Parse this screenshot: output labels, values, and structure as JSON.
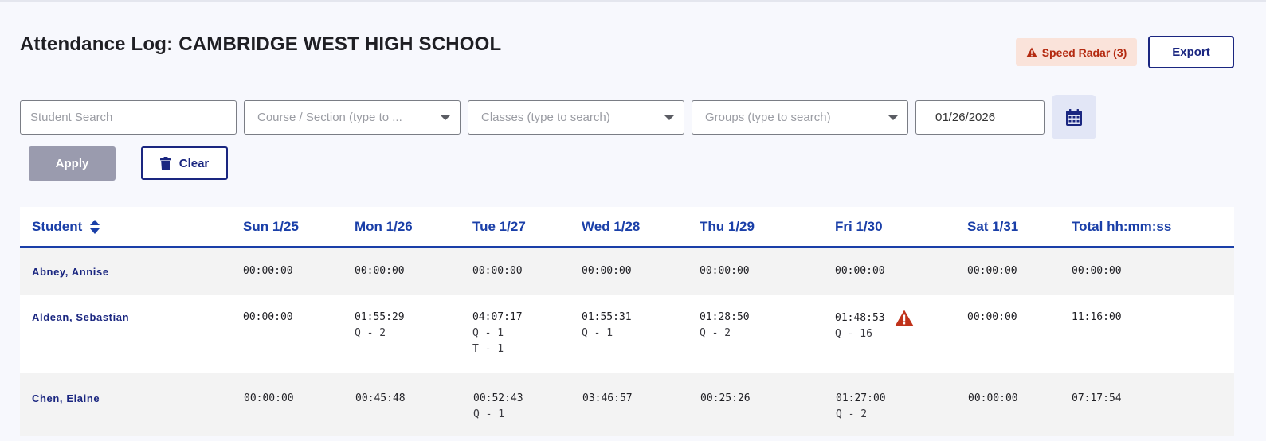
{
  "page": {
    "title": "Attendance Log: CAMBRIDGE WEST HIGH SCHOOL"
  },
  "header": {
    "radar_label": "Speed Radar (3)",
    "export_label": "Export"
  },
  "filters": {
    "student_placeholder": "Student Search",
    "course_placeholder": "Course / Section (type to ...",
    "classes_placeholder": "Classes (type to search)",
    "groups_placeholder": "Groups (type to search)",
    "date_value": "01/26/2026",
    "apply_label": "Apply",
    "clear_label": "Clear"
  },
  "table": {
    "columns": [
      "Student",
      "Sun 1/25",
      "Mon 1/26",
      "Tue 1/27",
      "Wed 1/28",
      "Thu 1/29",
      "Fri 1/30",
      "Sat 1/31",
      "Total hh:mm:ss"
    ],
    "rows": [
      {
        "name": "Abney, Annise",
        "cells": [
          {
            "time": "00:00:00",
            "subs": []
          },
          {
            "time": "00:00:00",
            "subs": []
          },
          {
            "time": "00:00:00",
            "subs": []
          },
          {
            "time": "00:00:00",
            "subs": []
          },
          {
            "time": "00:00:00",
            "subs": []
          },
          {
            "time": "00:00:00",
            "subs": []
          },
          {
            "time": "00:00:00",
            "subs": []
          }
        ],
        "total": "00:00:00"
      },
      {
        "name": "Aldean, Sebastian",
        "cells": [
          {
            "time": "00:00:00",
            "subs": []
          },
          {
            "time": "01:55:29",
            "subs": [
              "Q - 2"
            ]
          },
          {
            "time": "04:07:17",
            "subs": [
              "Q - 1",
              "T - 1"
            ]
          },
          {
            "time": "01:55:31",
            "subs": [
              "Q - 1"
            ]
          },
          {
            "time": "01:28:50",
            "subs": [
              "Q - 2"
            ]
          },
          {
            "time": "01:48:53",
            "subs": [
              "Q - 16"
            ],
            "warning": true
          },
          {
            "time": "00:00:00",
            "subs": []
          }
        ],
        "total": "11:16:00"
      },
      {
        "name": "Chen, Elaine",
        "cells": [
          {
            "time": "00:00:00",
            "subs": []
          },
          {
            "time": "00:45:48",
            "subs": []
          },
          {
            "time": "00:52:43",
            "subs": [
              "Q - 1"
            ]
          },
          {
            "time": "03:46:57",
            "subs": []
          },
          {
            "time": "00:25:26",
            "subs": []
          },
          {
            "time": "01:27:00",
            "subs": [
              "Q - 2"
            ]
          },
          {
            "time": "00:00:00",
            "subs": []
          }
        ],
        "total": "07:17:54"
      }
    ]
  },
  "colors": {
    "accent": "#1a3fa8",
    "navy": "#1a2680",
    "warning": "#c0321a",
    "badge_bg": "#fae3da"
  },
  "icons": {
    "warning": "warning-icon",
    "calendar": "calendar-icon",
    "trash": "trash-icon",
    "sort": "sort-icon"
  }
}
